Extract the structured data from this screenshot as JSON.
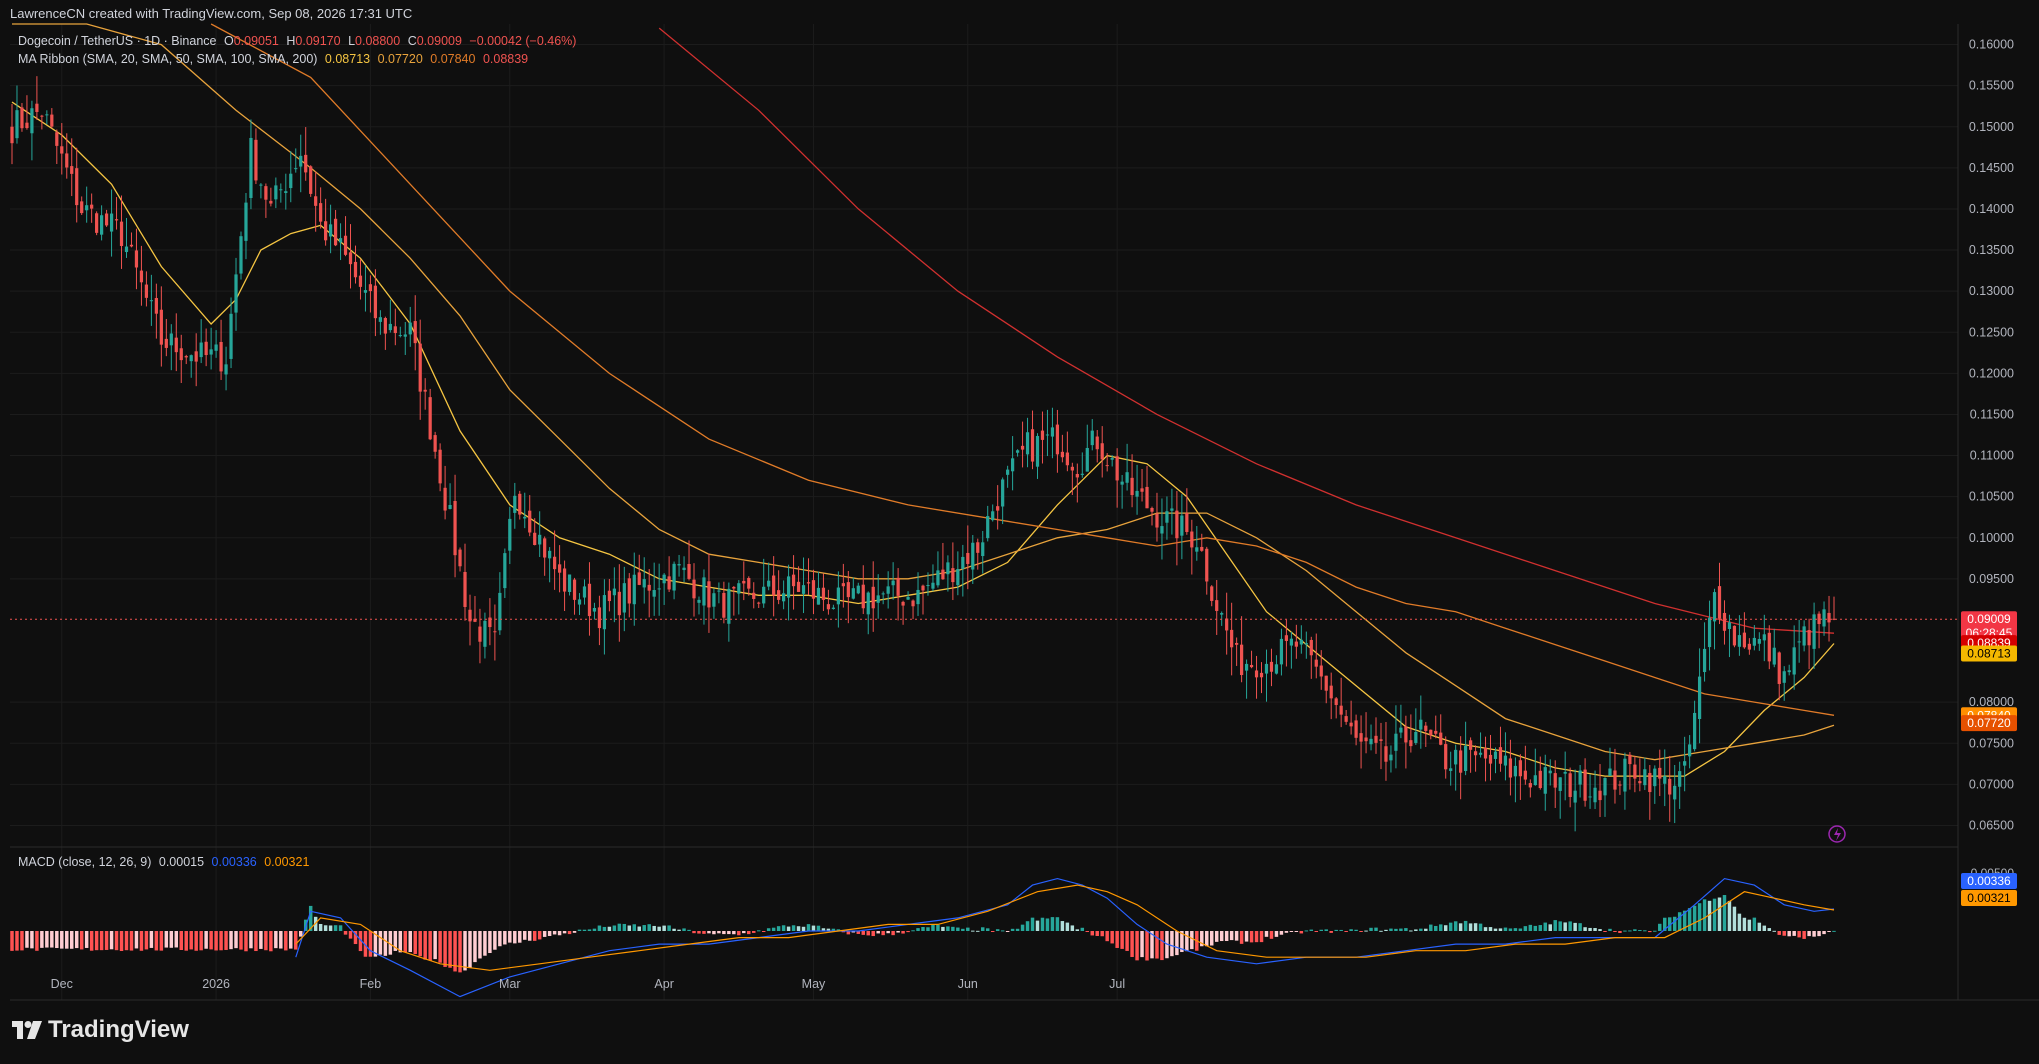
{
  "header": {
    "created_by": "LawrenceCN created with TradingView.com, Sep 08, 2026 17:31 UTC"
  },
  "symbol_legend": {
    "name": "Dogecoin / TetherUS · 1D · Binance",
    "o_label": "O",
    "o_value": "0.09051",
    "h_label": "H",
    "h_value": "0.09170",
    "l_label": "L",
    "l_value": "0.08800",
    "c_label": "C",
    "c_value": "0.09009",
    "change": "−0.00042 (−0.46%)"
  },
  "ma_legend": {
    "name": "MA Ribbon (SMA, 20, SMA, 50, SMA, 100, SMA, 200)",
    "v20": "0.08713",
    "v50": "0.07720",
    "v100": "0.07840",
    "v200": "0.08839"
  },
  "macd_legend": {
    "name": "MACD (close, 12, 26, 9)",
    "hist": "0.00015",
    "macd": "0.00336",
    "signal": "0.00321"
  },
  "price_badges": {
    "last": "0.09009",
    "countdown": "06:28:45",
    "sma200": "0.08839",
    "sma20": "0.08713",
    "sma100": "0.07840",
    "sma50": "0.07720"
  },
  "macd_badges": {
    "macd": "0.00336",
    "signal": "0.00321",
    "top_tick": "0.00500"
  },
  "colors": {
    "up": "#26a69a",
    "down": "#ef5350",
    "sma20": "#f5c542",
    "sma50": "#e8a33c",
    "sma100": "#e07b28",
    "sma200": "#d0302f",
    "macd": "#2962ff",
    "signal": "#ff9800",
    "hist_up_strong": "#26a69a",
    "hist_up_weak": "#b2dfdb",
    "hist_down_strong": "#ff5252",
    "hist_down_weak": "#ffcdd2"
  },
  "logo_text": "TradingView",
  "chart_data": {
    "type": "candlestick",
    "symbol": "Dogecoin / TetherUS",
    "timeframe": "1D",
    "exchange": "Binance",
    "x_tick_labels": [
      "Dec",
      "2026",
      "Feb",
      "Mar",
      "Apr",
      "May",
      "Jun",
      "Jul"
    ],
    "y_tick_labels": [
      "0.16000",
      "0.15500",
      "0.15000",
      "0.14500",
      "0.14000",
      "0.13500",
      "0.13000",
      "0.12500",
      "0.12000",
      "0.11500",
      "0.11000",
      "0.10500",
      "0.10000",
      "0.09500",
      "0.08000",
      "0.07500",
      "0.07000",
      "0.06500"
    ],
    "y_ticks": [
      0.16,
      0.155,
      0.15,
      0.145,
      0.14,
      0.135,
      0.13,
      0.125,
      0.12,
      0.115,
      0.11,
      0.105,
      0.1,
      0.095,
      0.08,
      0.075,
      0.07,
      0.065
    ],
    "ylim": [
      0.0625,
      0.1625
    ],
    "close_anchors_by_bar": [
      [
        0,
        0.15
      ],
      [
        6,
        0.152
      ],
      [
        14,
        0.14
      ],
      [
        22,
        0.137
      ],
      [
        30,
        0.124
      ],
      [
        38,
        0.122
      ],
      [
        43,
        0.122
      ],
      [
        48,
        0.147
      ],
      [
        52,
        0.14
      ],
      [
        58,
        0.147
      ],
      [
        62,
        0.138
      ],
      [
        66,
        0.135
      ],
      [
        74,
        0.126
      ],
      [
        80,
        0.125
      ],
      [
        86,
        0.108
      ],
      [
        92,
        0.09
      ],
      [
        97,
        0.087
      ],
      [
        101,
        0.106
      ],
      [
        110,
        0.095
      ],
      [
        118,
        0.091
      ],
      [
        126,
        0.094
      ],
      [
        134,
        0.096
      ],
      [
        142,
        0.092
      ],
      [
        150,
        0.093
      ],
      [
        158,
        0.094
      ],
      [
        166,
        0.092
      ],
      [
        174,
        0.093
      ],
      [
        182,
        0.093
      ],
      [
        188,
        0.096
      ],
      [
        194,
        0.099
      ],
      [
        198,
        0.105
      ],
      [
        204,
        0.111
      ],
      [
        210,
        0.112
      ],
      [
        214,
        0.109
      ],
      [
        218,
        0.112
      ],
      [
        224,
        0.106
      ],
      [
        232,
        0.102
      ],
      [
        238,
        0.1
      ],
      [
        242,
        0.092
      ],
      [
        246,
        0.085
      ],
      [
        252,
        0.085
      ],
      [
        258,
        0.087
      ],
      [
        264,
        0.082
      ],
      [
        270,
        0.075
      ],
      [
        276,
        0.073
      ],
      [
        282,
        0.077
      ],
      [
        288,
        0.073
      ],
      [
        296,
        0.073
      ],
      [
        304,
        0.071
      ],
      [
        312,
        0.07
      ],
      [
        320,
        0.07
      ],
      [
        326,
        0.072
      ],
      [
        332,
        0.07
      ],
      [
        336,
        0.071
      ],
      [
        339,
        0.082
      ],
      [
        342,
        0.093
      ],
      [
        346,
        0.088
      ],
      [
        352,
        0.087
      ],
      [
        356,
        0.083
      ],
      [
        360,
        0.088
      ],
      [
        364,
        0.09
      ],
      [
        366,
        0.09
      ]
    ],
    "ma_anchors_by_bar": {
      "sma20": [
        [
          0,
          0.153
        ],
        [
          10,
          0.149
        ],
        [
          20,
          0.143
        ],
        [
          30,
          0.133
        ],
        [
          40,
          0.126
        ],
        [
          45,
          0.129
        ],
        [
          50,
          0.135
        ],
        [
          56,
          0.137
        ],
        [
          62,
          0.138
        ],
        [
          70,
          0.134
        ],
        [
          80,
          0.126
        ],
        [
          90,
          0.113
        ],
        [
          100,
          0.104
        ],
        [
          110,
          0.1
        ],
        [
          120,
          0.098
        ],
        [
          130,
          0.095
        ],
        [
          140,
          0.094
        ],
        [
          150,
          0.093
        ],
        [
          160,
          0.093
        ],
        [
          170,
          0.092
        ],
        [
          180,
          0.093
        ],
        [
          190,
          0.094
        ],
        [
          200,
          0.097
        ],
        [
          210,
          0.104
        ],
        [
          220,
          0.11
        ],
        [
          228,
          0.109
        ],
        [
          236,
          0.105
        ],
        [
          244,
          0.098
        ],
        [
          252,
          0.091
        ],
        [
          260,
          0.087
        ],
        [
          270,
          0.082
        ],
        [
          280,
          0.077
        ],
        [
          290,
          0.075
        ],
        [
          300,
          0.074
        ],
        [
          310,
          0.072
        ],
        [
          320,
          0.071
        ],
        [
          330,
          0.071
        ],
        [
          336,
          0.071
        ],
        [
          344,
          0.074
        ],
        [
          352,
          0.079
        ],
        [
          360,
          0.083
        ],
        [
          366,
          0.08713
        ]
      ],
      "sma50": [
        [
          0,
          0.175
        ],
        [
          15,
          0.168
        ],
        [
          30,
          0.16
        ],
        [
          45,
          0.152
        ],
        [
          60,
          0.145
        ],
        [
          70,
          0.14
        ],
        [
          80,
          0.134
        ],
        [
          90,
          0.127
        ],
        [
          100,
          0.118
        ],
        [
          110,
          0.112
        ],
        [
          120,
          0.106
        ],
        [
          130,
          0.101
        ],
        [
          140,
          0.098
        ],
        [
          150,
          0.097
        ],
        [
          160,
          0.096
        ],
        [
          170,
          0.095
        ],
        [
          180,
          0.095
        ],
        [
          190,
          0.096
        ],
        [
          200,
          0.098
        ],
        [
          210,
          0.1
        ],
        [
          220,
          0.101
        ],
        [
          230,
          0.103
        ],
        [
          240,
          0.103
        ],
        [
          250,
          0.1
        ],
        [
          260,
          0.096
        ],
        [
          270,
          0.091
        ],
        [
          280,
          0.086
        ],
        [
          290,
          0.082
        ],
        [
          300,
          0.078
        ],
        [
          310,
          0.076
        ],
        [
          320,
          0.074
        ],
        [
          330,
          0.073
        ],
        [
          340,
          0.074
        ],
        [
          350,
          0.075
        ],
        [
          360,
          0.076
        ],
        [
          366,
          0.0772
        ]
      ],
      "sma100": [
        [
          40,
          0.164
        ],
        [
          60,
          0.156
        ],
        [
          80,
          0.143
        ],
        [
          100,
          0.13
        ],
        [
          120,
          0.12
        ],
        [
          140,
          0.112
        ],
        [
          160,
          0.107
        ],
        [
          180,
          0.104
        ],
        [
          200,
          0.102
        ],
        [
          210,
          0.101
        ],
        [
          220,
          0.1
        ],
        [
          230,
          0.099
        ],
        [
          240,
          0.1
        ],
        [
          250,
          0.099
        ],
        [
          260,
          0.097
        ],
        [
          270,
          0.094
        ],
        [
          280,
          0.092
        ],
        [
          290,
          0.091
        ],
        [
          300,
          0.089
        ],
        [
          310,
          0.087
        ],
        [
          320,
          0.085
        ],
        [
          330,
          0.083
        ],
        [
          340,
          0.081
        ],
        [
          350,
          0.08
        ],
        [
          360,
          0.079
        ],
        [
          366,
          0.0784
        ]
      ],
      "sma200": [
        [
          130,
          0.162
        ],
        [
          150,
          0.152
        ],
        [
          170,
          0.14
        ],
        [
          190,
          0.13
        ],
        [
          210,
          0.122
        ],
        [
          230,
          0.115
        ],
        [
          250,
          0.109
        ],
        [
          270,
          0.104
        ],
        [
          290,
          0.1
        ],
        [
          310,
          0.096
        ],
        [
          330,
          0.092
        ],
        [
          350,
          0.089
        ],
        [
          366,
          0.08839
        ]
      ]
    },
    "macd_series": {
      "macd": [
        [
          57,
          -0.004
        ],
        [
          60,
          0.003
        ],
        [
          66,
          0.002
        ],
        [
          72,
          -0.003
        ],
        [
          80,
          -0.006
        ],
        [
          90,
          -0.01
        ],
        [
          100,
          -0.007
        ],
        [
          110,
          -0.005
        ],
        [
          120,
          -0.003
        ],
        [
          130,
          -0.002
        ],
        [
          140,
          -0.002
        ],
        [
          150,
          -0.001
        ],
        [
          160,
          0.0
        ],
        [
          170,
          0.0
        ],
        [
          180,
          0.001
        ],
        [
          190,
          0.002
        ],
        [
          200,
          0.004
        ],
        [
          205,
          0.007
        ],
        [
          210,
          0.008
        ],
        [
          215,
          0.007
        ],
        [
          220,
          0.005
        ],
        [
          226,
          0.001
        ],
        [
          232,
          -0.002
        ],
        [
          240,
          -0.004
        ],
        [
          250,
          -0.005
        ],
        [
          260,
          -0.004
        ],
        [
          270,
          -0.004
        ],
        [
          280,
          -0.003
        ],
        [
          290,
          -0.002
        ],
        [
          300,
          -0.002
        ],
        [
          310,
          -0.001
        ],
        [
          320,
          -0.001
        ],
        [
          330,
          -0.001
        ],
        [
          338,
          0.004
        ],
        [
          344,
          0.008
        ],
        [
          350,
          0.007
        ],
        [
          356,
          0.004
        ],
        [
          362,
          0.003
        ],
        [
          366,
          0.00336
        ]
      ],
      "signal": [
        [
          57,
          -0.002
        ],
        [
          62,
          0.002
        ],
        [
          70,
          0.001
        ],
        [
          78,
          -0.003
        ],
        [
          86,
          -0.005
        ],
        [
          96,
          -0.006
        ],
        [
          106,
          -0.005
        ],
        [
          116,
          -0.004
        ],
        [
          126,
          -0.003
        ],
        [
          136,
          -0.002
        ],
        [
          146,
          -0.001
        ],
        [
          156,
          -0.001
        ],
        [
          166,
          0.0
        ],
        [
          176,
          0.001
        ],
        [
          186,
          0.001
        ],
        [
          196,
          0.003
        ],
        [
          206,
          0.006
        ],
        [
          214,
          0.007
        ],
        [
          220,
          0.006
        ],
        [
          226,
          0.004
        ],
        [
          234,
          0.0
        ],
        [
          242,
          -0.003
        ],
        [
          252,
          -0.004
        ],
        [
          262,
          -0.004
        ],
        [
          272,
          -0.004
        ],
        [
          282,
          -0.003
        ],
        [
          292,
          -0.003
        ],
        [
          302,
          -0.002
        ],
        [
          312,
          -0.002
        ],
        [
          322,
          -0.001
        ],
        [
          332,
          -0.001
        ],
        [
          340,
          0.002
        ],
        [
          348,
          0.006
        ],
        [
          354,
          0.005
        ],
        [
          360,
          0.004
        ],
        [
          366,
          0.00321
        ]
      ]
    },
    "macd_ylim": [
      -0.009,
      0.009
    ]
  }
}
